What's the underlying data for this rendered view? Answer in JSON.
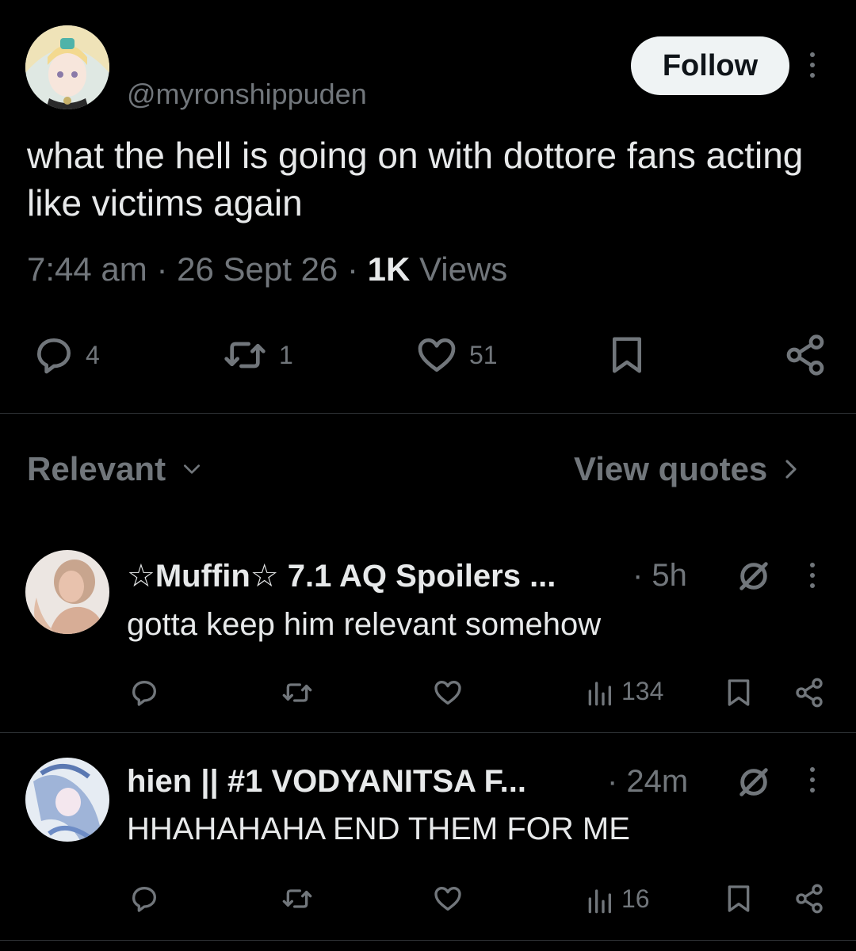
{
  "post": {
    "handle": "@myronshippuden",
    "follow_label": "Follow",
    "text": "what the hell is going on with dottore fans acting like victims again",
    "time": "7:44 am",
    "date": "26 Sept 26",
    "views_count": "1K",
    "views_label": "Views",
    "sep": "·",
    "actions": {
      "replies": "4",
      "reposts": "1",
      "likes": "51"
    }
  },
  "sort": {
    "label": "Relevant",
    "quotes_label": "View quotes"
  },
  "replies": [
    {
      "name": "☆Muffin☆ 7.1 AQ Spoilers ...",
      "time": "· 5h",
      "text": "gotta keep him relevant somehow",
      "views": "134"
    },
    {
      "name": "hien || #1 VODYANITSA F...",
      "time": "· 24m",
      "text": "HHAHAHAHA END THEM FOR ME",
      "views": "16"
    }
  ],
  "colors": {
    "background": "#000000",
    "text": "#e7e9ea",
    "muted": "#71767b",
    "divider": "#2f3336",
    "follow_bg": "#eff3f4"
  },
  "icons": [
    "reply-icon",
    "repost-icon",
    "like-icon",
    "bookmark-icon",
    "share-icon",
    "views-icon",
    "muted-icon",
    "more-icon",
    "chevron-down-icon",
    "chevron-right-icon"
  ]
}
